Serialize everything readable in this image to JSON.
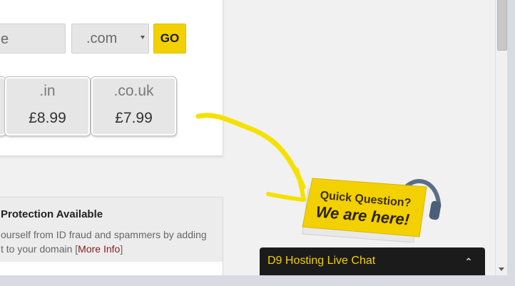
{
  "domain_search": {
    "input_value": "e",
    "tld_selected": ".com",
    "go_label": "GO"
  },
  "prices": [
    {
      "tld": ".in",
      "price": "£8.99"
    },
    {
      "tld": ".co.uk",
      "price": "£7.99"
    }
  ],
  "protection": {
    "title": "Protection Available",
    "line1": "ourself from ID fraud and spammers by adding",
    "line2_prefix": "t to your domain [",
    "link": "More Info",
    "line2_suffix": "]"
  },
  "badge": {
    "line1": "Quick Question?",
    "line2": "We are here!"
  },
  "chat": {
    "title": "D9 Hosting Live Chat",
    "toggle_icon": "chevron-up-icon"
  },
  "colors": {
    "accent_yellow": "#f3d000",
    "chat_bg": "#1b1b1b",
    "link": "#8a1c1c"
  }
}
